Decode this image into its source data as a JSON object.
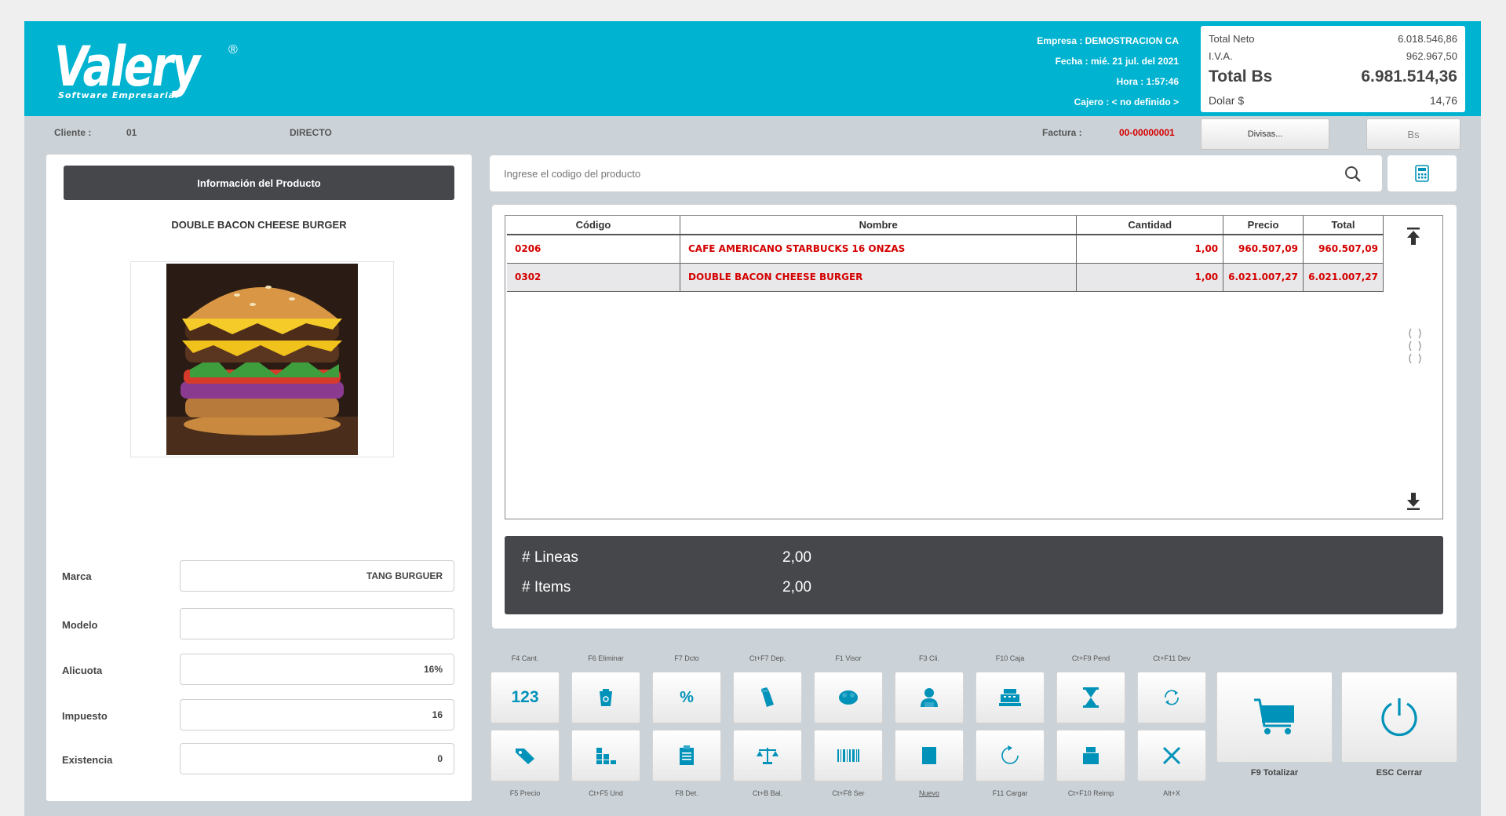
{
  "header": {
    "logo": "Valery",
    "logo_reg": "®",
    "logo_sub": "Software Empresarial",
    "empresa": "Empresa : DEMOSTRACION CA",
    "fecha": "Fecha : mié. 21 jul. del 2021",
    "hora": "Hora : 1:57:46",
    "cajero": "Cajero : < no definido >"
  },
  "totals": {
    "neto_label": "Total Neto",
    "neto_value": "6.018.546,86",
    "iva_label": "I.V.A.",
    "iva_value": "962.967,50",
    "total_label": "Total Bs",
    "total_value": "6.981.514,36",
    "dolar_label": "Dolar $",
    "dolar_value": "14,76"
  },
  "client_bar": {
    "cliente_label": "Cliente :",
    "cliente_code": "01",
    "cliente_name": "DIRECTO",
    "factura_label": "Factura :",
    "factura_value": "00-00000001",
    "divisas_button": "Divisas...",
    "bs_button": "Bs"
  },
  "product_panel": {
    "title": "Información del Producto",
    "name": "DOUBLE BACON CHEESE BURGER",
    "image_icon": "burger-image",
    "fields": [
      {
        "label": "Marca",
        "value": "TANG BURGUER"
      },
      {
        "label": "Modelo",
        "value": ""
      },
      {
        "label": "Alicuota",
        "value": "16%"
      },
      {
        "label": "Impuesto",
        "value": "16"
      },
      {
        "label": "Existencia",
        "value": "0"
      }
    ]
  },
  "search": {
    "placeholder": "Ingrese el codigo del producto",
    "icon": "search-icon",
    "calc_icon": "calculator-icon"
  },
  "grid": {
    "columns": [
      "Código",
      "Nombre",
      "Cantidad",
      "Precio",
      "Total"
    ],
    "rows": [
      {
        "codigo": "0206",
        "nombre": "CAFE AMERICANO STARBUCKS 16 ONZAS",
        "cantidad": "1,00",
        "precio": "960.507,09",
        "total": "960.507,09"
      },
      {
        "codigo": "0302",
        "nombre": "DOUBLE BACON CHEESE BURGER",
        "cantidad": "1,00",
        "precio": "6.021.007,27",
        "total": "6.021.007,27"
      }
    ]
  },
  "summary": {
    "lineas_label": "# Lineas",
    "lineas_value": "2,00",
    "items_label": "# Items",
    "items_value": "2,00"
  },
  "function_keys": {
    "top_labels": [
      "F4 Cant.",
      "F6 Eliminar",
      "F7 Dcto",
      "Ct+F7 Dep.",
      "F1 Visor",
      "F3 Cli.",
      "F10 Caja",
      "Ct+F9 Pend",
      "Ct+F11 Dev"
    ],
    "row1_icons": [
      "keypad-123-icon",
      "trash-icon",
      "percent-icon",
      "deposit-bag-icon",
      "piggy-bank-icon",
      "client-user-icon",
      "cash-register-icon",
      "hourglass-icon",
      "return-cycle-icon"
    ],
    "row1_text": "123",
    "bottom_labels": [
      "F5 Precio",
      "Ct+F5 Und",
      "F8 Det.",
      "Ct+B Bal.",
      "Ct+F8 Ser",
      "Nuevo",
      "F11 Cargar",
      "Ct+F10 Reimp",
      "Alt+X"
    ],
    "row2_icons": [
      "price-tag-icon",
      "units-blocks-icon",
      "clipboard-icon",
      "scale-icon",
      "barcode-icon",
      "new-document-icon",
      "reload-icon",
      "printer-icon",
      "close-x-icon"
    ],
    "totalizar": "F9 Totalizar",
    "cerrar": "ESC Cerrar",
    "accent": "#0092b8"
  }
}
